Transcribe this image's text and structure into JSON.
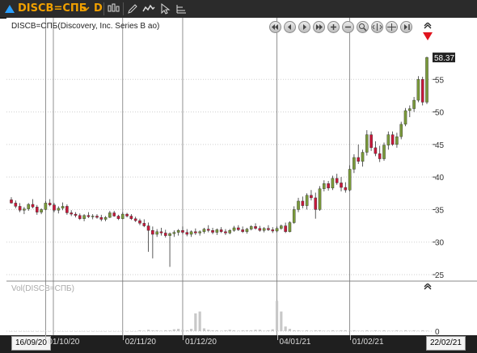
{
  "toolbar": {
    "symbol": "DISCB=СПБ",
    "timeframe": "D",
    "icons": [
      "up-triangle-icon",
      "chevron-down-icon",
      "candles-icon",
      "pencil-icon",
      "indicator-icon",
      "cursor-icon",
      "settings-icon"
    ]
  },
  "chart": {
    "title": "DISCB=СПБ(Discovery, Inc. Series B ao)",
    "volume_title": "Vol(DISCB=СПБ)",
    "last_price_label": "58.37",
    "start_date_label": "16/09/20",
    "end_date_label": "22/02/21",
    "nav_icons": [
      "first-icon",
      "prev-icon",
      "play-icon",
      "next-icon",
      "last-icon",
      "zoom-in-icon",
      "zoom-out-icon",
      "search-icon",
      "fit-icon",
      "shrink-icon",
      "forward-icon"
    ]
  },
  "chart_data": {
    "type": "candlestick",
    "y_ticks": [
      "25",
      "30",
      "35",
      "40",
      "45",
      "50",
      "55"
    ],
    "volume_ticks": [
      "0"
    ],
    "x_ticks": [
      "01/10/20",
      "02/11/20",
      "01/12/20",
      "04/01/21",
      "01/02/21"
    ],
    "ylim": [
      25,
      60
    ],
    "colors": {
      "up": "#7a9a3a",
      "down": "#c8173a",
      "volume": "#c8c8c8",
      "grid": "#cfcfcf",
      "vline": "#777777"
    },
    "candles": [
      [
        36.5,
        36.9,
        35.9,
        36.0
      ],
      [
        36.0,
        36.4,
        35.2,
        35.5
      ],
      [
        35.5,
        36.0,
        34.6,
        34.9
      ],
      [
        34.9,
        35.4,
        34.3,
        35.1
      ],
      [
        35.1,
        36.0,
        34.8,
        35.8
      ],
      [
        35.8,
        36.6,
        35.2,
        35.4
      ],
      [
        35.4,
        35.7,
        34.2,
        34.6
      ],
      [
        34.6,
        35.2,
        34.3,
        35.0
      ],
      [
        35.0,
        36.3,
        34.9,
        36.0
      ],
      [
        36.0,
        36.6,
        35.5,
        35.7
      ],
      [
        35.7,
        36.0,
        34.6,
        34.9
      ],
      [
        34.9,
        35.5,
        34.4,
        35.2
      ],
      [
        35.2,
        36.1,
        34.9,
        35.5
      ],
      [
        35.5,
        35.8,
        34.2,
        34.5
      ],
      [
        34.5,
        34.9,
        34.0,
        34.3
      ],
      [
        34.3,
        34.6,
        33.8,
        34.1
      ],
      [
        34.1,
        34.4,
        33.4,
        33.6
      ],
      [
        33.6,
        34.3,
        33.2,
        34.1
      ],
      [
        34.1,
        34.6,
        33.7,
        33.9
      ],
      [
        33.9,
        34.3,
        33.5,
        34.0
      ],
      [
        34.0,
        34.3,
        33.6,
        33.8
      ],
      [
        33.8,
        34.2,
        33.2,
        33.5
      ],
      [
        33.5,
        34.0,
        33.2,
        33.8
      ],
      [
        33.8,
        34.8,
        33.7,
        34.5
      ],
      [
        34.5,
        34.8,
        33.9,
        34.0
      ],
      [
        34.0,
        34.2,
        33.4,
        33.6
      ],
      [
        33.6,
        34.6,
        33.5,
        34.3
      ],
      [
        34.3,
        34.5,
        33.8,
        34.0
      ],
      [
        34.0,
        34.3,
        33.4,
        33.6
      ],
      [
        33.6,
        33.9,
        33.1,
        33.3
      ],
      [
        33.3,
        33.6,
        32.6,
        32.9
      ],
      [
        32.9,
        33.5,
        32.3,
        32.5
      ],
      [
        32.5,
        33.0,
        28.5,
        31.8
      ],
      [
        31.8,
        32.4,
        27.5,
        31.2
      ],
      [
        31.2,
        32.0,
        30.8,
        31.6
      ],
      [
        31.6,
        32.2,
        31.0,
        31.4
      ],
      [
        31.4,
        31.9,
        30.7,
        31.0
      ],
      [
        31.0,
        31.5,
        26.2,
        31.3
      ],
      [
        31.3,
        31.8,
        30.8,
        31.5
      ],
      [
        31.5,
        32.0,
        31.0,
        31.8
      ],
      [
        31.8,
        32.4,
        31.2,
        31.5
      ],
      [
        31.5,
        32.0,
        30.9,
        31.2
      ],
      [
        31.2,
        31.8,
        30.8,
        31.6
      ],
      [
        31.6,
        32.1,
        31.1,
        31.4
      ],
      [
        31.4,
        31.8,
        31.0,
        31.6
      ],
      [
        31.6,
        32.2,
        31.3,
        32.0
      ],
      [
        32.0,
        32.6,
        31.5,
        31.8
      ],
      [
        31.8,
        32.2,
        31.2,
        31.5
      ],
      [
        31.5,
        32.1,
        31.1,
        31.9
      ],
      [
        31.9,
        32.3,
        31.4,
        31.6
      ],
      [
        31.6,
        32.0,
        31.1,
        31.4
      ],
      [
        31.4,
        32.0,
        31.2,
        31.8
      ],
      [
        31.8,
        32.5,
        31.6,
        32.2
      ],
      [
        32.2,
        32.6,
        31.7,
        31.9
      ],
      [
        31.9,
        32.4,
        31.4,
        31.6
      ],
      [
        31.6,
        32.2,
        31.3,
        32.0
      ],
      [
        32.0,
        32.6,
        31.8,
        32.4
      ],
      [
        32.4,
        32.9,
        31.9,
        32.1
      ],
      [
        32.1,
        32.5,
        31.6,
        31.8
      ],
      [
        31.8,
        32.3,
        31.5,
        32.1
      ],
      [
        32.1,
        32.6,
        31.7,
        31.9
      ],
      [
        31.9,
        32.3,
        31.4,
        31.7
      ],
      [
        31.7,
        32.4,
        31.5,
        32.1
      ],
      [
        32.1,
        32.7,
        31.9,
        32.5
      ],
      [
        32.5,
        33.0,
        31.4,
        31.6
      ],
      [
        31.6,
        33.2,
        31.5,
        33.0
      ],
      [
        33.0,
        35.5,
        32.8,
        35.0
      ],
      [
        35.0,
        36.8,
        34.6,
        36.3
      ],
      [
        36.3,
        37.0,
        35.2,
        35.6
      ],
      [
        35.6,
        37.5,
        35.0,
        37.2
      ],
      [
        37.2,
        38.0,
        36.4,
        36.8
      ],
      [
        36.8,
        37.6,
        33.6,
        35.0
      ],
      [
        35.0,
        38.6,
        34.8,
        38.2
      ],
      [
        38.2,
        39.5,
        37.8,
        39.0
      ],
      [
        39.0,
        39.4,
        37.9,
        38.3
      ],
      [
        38.3,
        40.2,
        38.0,
        39.8
      ],
      [
        39.8,
        40.5,
        38.8,
        39.1
      ],
      [
        39.1,
        40.0,
        37.8,
        38.4
      ],
      [
        38.4,
        39.2,
        37.6,
        38.0
      ],
      [
        38.0,
        41.8,
        37.8,
        41.2
      ],
      [
        41.2,
        43.5,
        40.6,
        43.0
      ],
      [
        43.0,
        45.0,
        42.0,
        42.4
      ],
      [
        42.4,
        44.2,
        41.6,
        43.8
      ],
      [
        43.8,
        47.2,
        43.3,
        46.5
      ],
      [
        46.5,
        47.0,
        44.0,
        44.5
      ],
      [
        44.5,
        45.5,
        43.2,
        43.6
      ],
      [
        43.6,
        44.8,
        42.3,
        42.8
      ],
      [
        42.8,
        45.3,
        42.5,
        44.9
      ],
      [
        44.9,
        47.0,
        44.2,
        46.5
      ],
      [
        46.5,
        47.0,
        44.8,
        45.0
      ],
      [
        45.0,
        46.8,
        44.5,
        46.2
      ],
      [
        46.2,
        48.5,
        45.8,
        48.1
      ],
      [
        48.1,
        50.6,
        47.8,
        50.2
      ],
      [
        50.2,
        51.0,
        49.2,
        50.5
      ],
      [
        50.5,
        52.3,
        50.0,
        51.8
      ],
      [
        51.8,
        55.5,
        51.5,
        55.0
      ],
      [
        55.0,
        55.4,
        51.0,
        51.5
      ],
      [
        51.5,
        58.5,
        51.2,
        58.37
      ]
    ],
    "volume": [
      0,
      0,
      0,
      0,
      0,
      0,
      0,
      0,
      0,
      0,
      0,
      0,
      0,
      0,
      0,
      0,
      0,
      0,
      0,
      0,
      0,
      0,
      0,
      0,
      0,
      0,
      0,
      0,
      0,
      0,
      0.02,
      0.01,
      0.03,
      0.02,
      0.02,
      0.01,
      0.02,
      0.02,
      0.04,
      0.05,
      0.03,
      0.02,
      0.05,
      0.38,
      0.42,
      0.06,
      0.03,
      0.02,
      0.02,
      0.01,
      0.02,
      0.03,
      0.02,
      0.01,
      0.02,
      0.02,
      0.02,
      0.03,
      0.03,
      0.01,
      0.02,
      0.04,
      0.65,
      0.42,
      0.1,
      0.05,
      0.02,
      0.02,
      0.01,
      0.02,
      0.01,
      0.02,
      0.02,
      0.01,
      0.01,
      0.02,
      0.01,
      0.02,
      0.02,
      0.01,
      0.02,
      0.01,
      0.01,
      0.02,
      0.01,
      0.02,
      0.01,
      0.02,
      0.01,
      0.01,
      0.02,
      0.01,
      0.02,
      0.01,
      0.02,
      0.01,
      0.02,
      0.01
    ]
  }
}
